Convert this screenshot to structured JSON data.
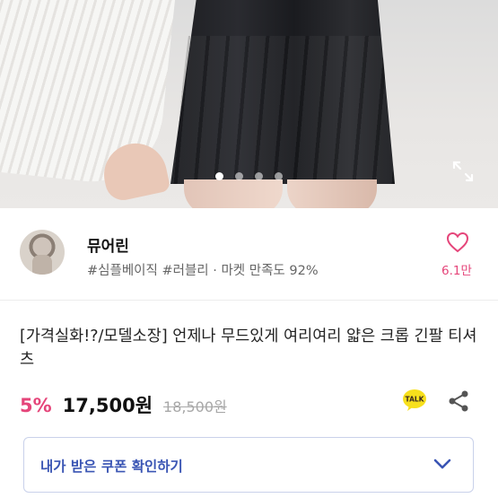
{
  "gallery": {
    "slide_count": 4,
    "active_slide": 1,
    "expand_icon": "expand-icon"
  },
  "shop": {
    "name": "뮤어린",
    "tags": "#심플베이직 #러블리 · 마켓 만족도 92%",
    "likes": "6.1만",
    "heart_icon": "heart-outline-icon"
  },
  "product": {
    "title": "[가격실화!?/모델소장] 언제나 무드있게 여리여리 얇은 크롭 긴팔 티셔츠",
    "discount": "5%",
    "price": "17,500원",
    "original_price": "18,500원"
  },
  "actions": {
    "talk_label": "TALK",
    "share_icon": "share-icon"
  },
  "coupon": {
    "label": "내가 받은 쿠폰 확인하기",
    "chevron_icon": "chevron-down-icon"
  },
  "colors": {
    "accent_pink": "#e5457a",
    "coupon_blue": "#3a55b4",
    "kakao_yellow": "#f7e01c"
  }
}
